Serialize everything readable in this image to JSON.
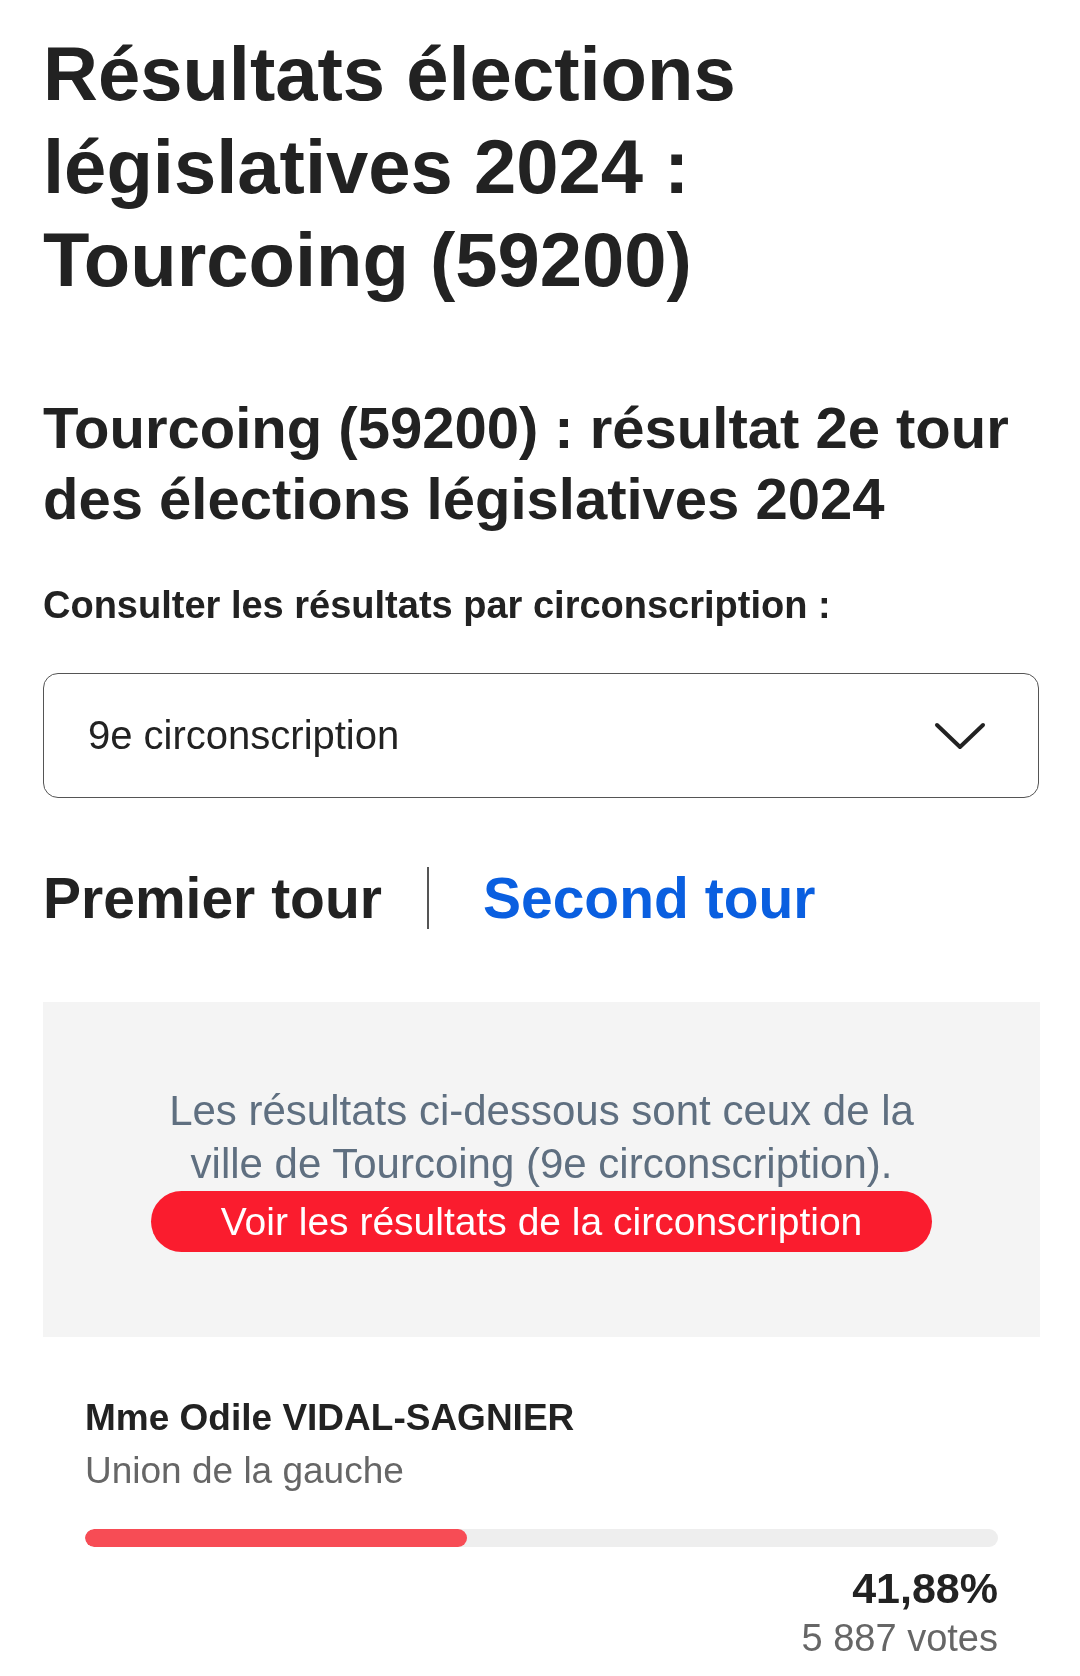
{
  "title": "Résultats élections législatives 2024 : Tourcoing (59200)",
  "subtitle": "Tourcoing (59200) : résultat 2e tour des élections législatives 2024",
  "selector": {
    "label": "Consulter les résultats par circonscription :",
    "value": "9e circonscription"
  },
  "tabs": [
    {
      "label": "Premier tour",
      "selected": false
    },
    {
      "label": "Second tour",
      "selected": true
    }
  ],
  "notice": {
    "text": "Les résultats ci-dessous sont ceux de la ville de Tourcoing (9e circonscription).",
    "button": "Voir les résultats de la circonscription"
  },
  "candidates": [
    {
      "name": "Mme Odile VIDAL-SAGNIER",
      "party": "Union de la gauche",
      "level": 0.4188,
      "color": "#f74c55",
      "percent": "41,88%",
      "votes": "5 887 votes"
    }
  ]
}
